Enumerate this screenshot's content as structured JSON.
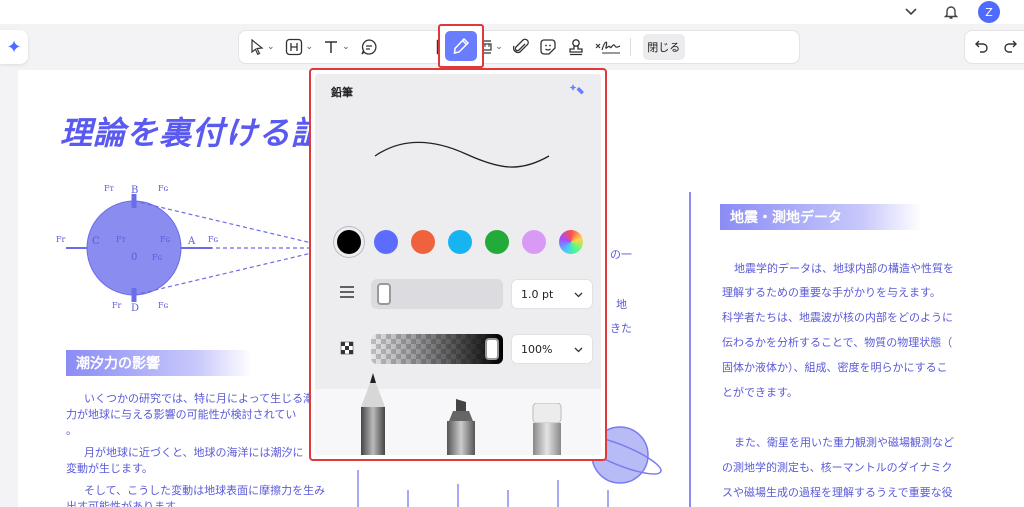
{
  "toolbar": {
    "close_label": "閉じる"
  },
  "document": {
    "title": "理論を裏付ける証",
    "tidal_section": {
      "heading": "潮汐力の影響",
      "lines": [
        "いくつかの研究では、特に月によって生じる潮",
        "力が地球に与える影響の可能性が検討されてい",
        "。",
        "月が地球に近づくと、地球の海洋には潮汐に",
        "変動が生じます。",
        "そして、こうした変動は地球表面に摩擦力を生み",
        "出す可能性があります。"
      ]
    },
    "middle_fragments": [
      "の一",
      "地",
      "きた"
    ],
    "seismic_section": {
      "heading": "地震・測地データ",
      "lines": [
        "地震学的データは、地球内部の構造や性質を",
        "理解するための重要な手がかりを与えます。",
        "科学者たちは、地震波が核の内部をどのように",
        "伝わるかを分析することで、物質の物理状態（",
        "固体か液体か）、組成、密度を明らかにするこ",
        "とができます。",
        "",
        "また、衛星を用いた重力観測や磁場観測など",
        "の測地学的測定も、核ーマントルのダイナミク",
        "スや磁場生成の過程を理解するうえで重要な役"
      ]
    },
    "diagram_labels": {
      "B": "B",
      "C": "C",
      "A": "A",
      "D": "D",
      "O": "0",
      "Ft": "Fт",
      "Fg": "Fɢ",
      "Fr": "Fr"
    }
  },
  "pencil_popup": {
    "title": "鉛筆",
    "colors": [
      "#000000",
      "#5b6cff",
      "#f0623d",
      "#18b4f2",
      "#22aa3a",
      "#d99af5",
      "rainbow"
    ],
    "selected_color_index": 0,
    "thickness": {
      "value": "1.0 pt",
      "level": 0.02
    },
    "opacity": {
      "value": "100%",
      "level": 1.0
    },
    "icons": [
      "thickness-icon",
      "opacity-icon",
      "ai-icon"
    ],
    "tools": [
      "pencil",
      "highlighter",
      "eraser"
    ]
  },
  "colors": {
    "accent": "#6a7cff",
    "highlight_border": "#e0383b",
    "doc_text": "#5a5ad8"
  }
}
